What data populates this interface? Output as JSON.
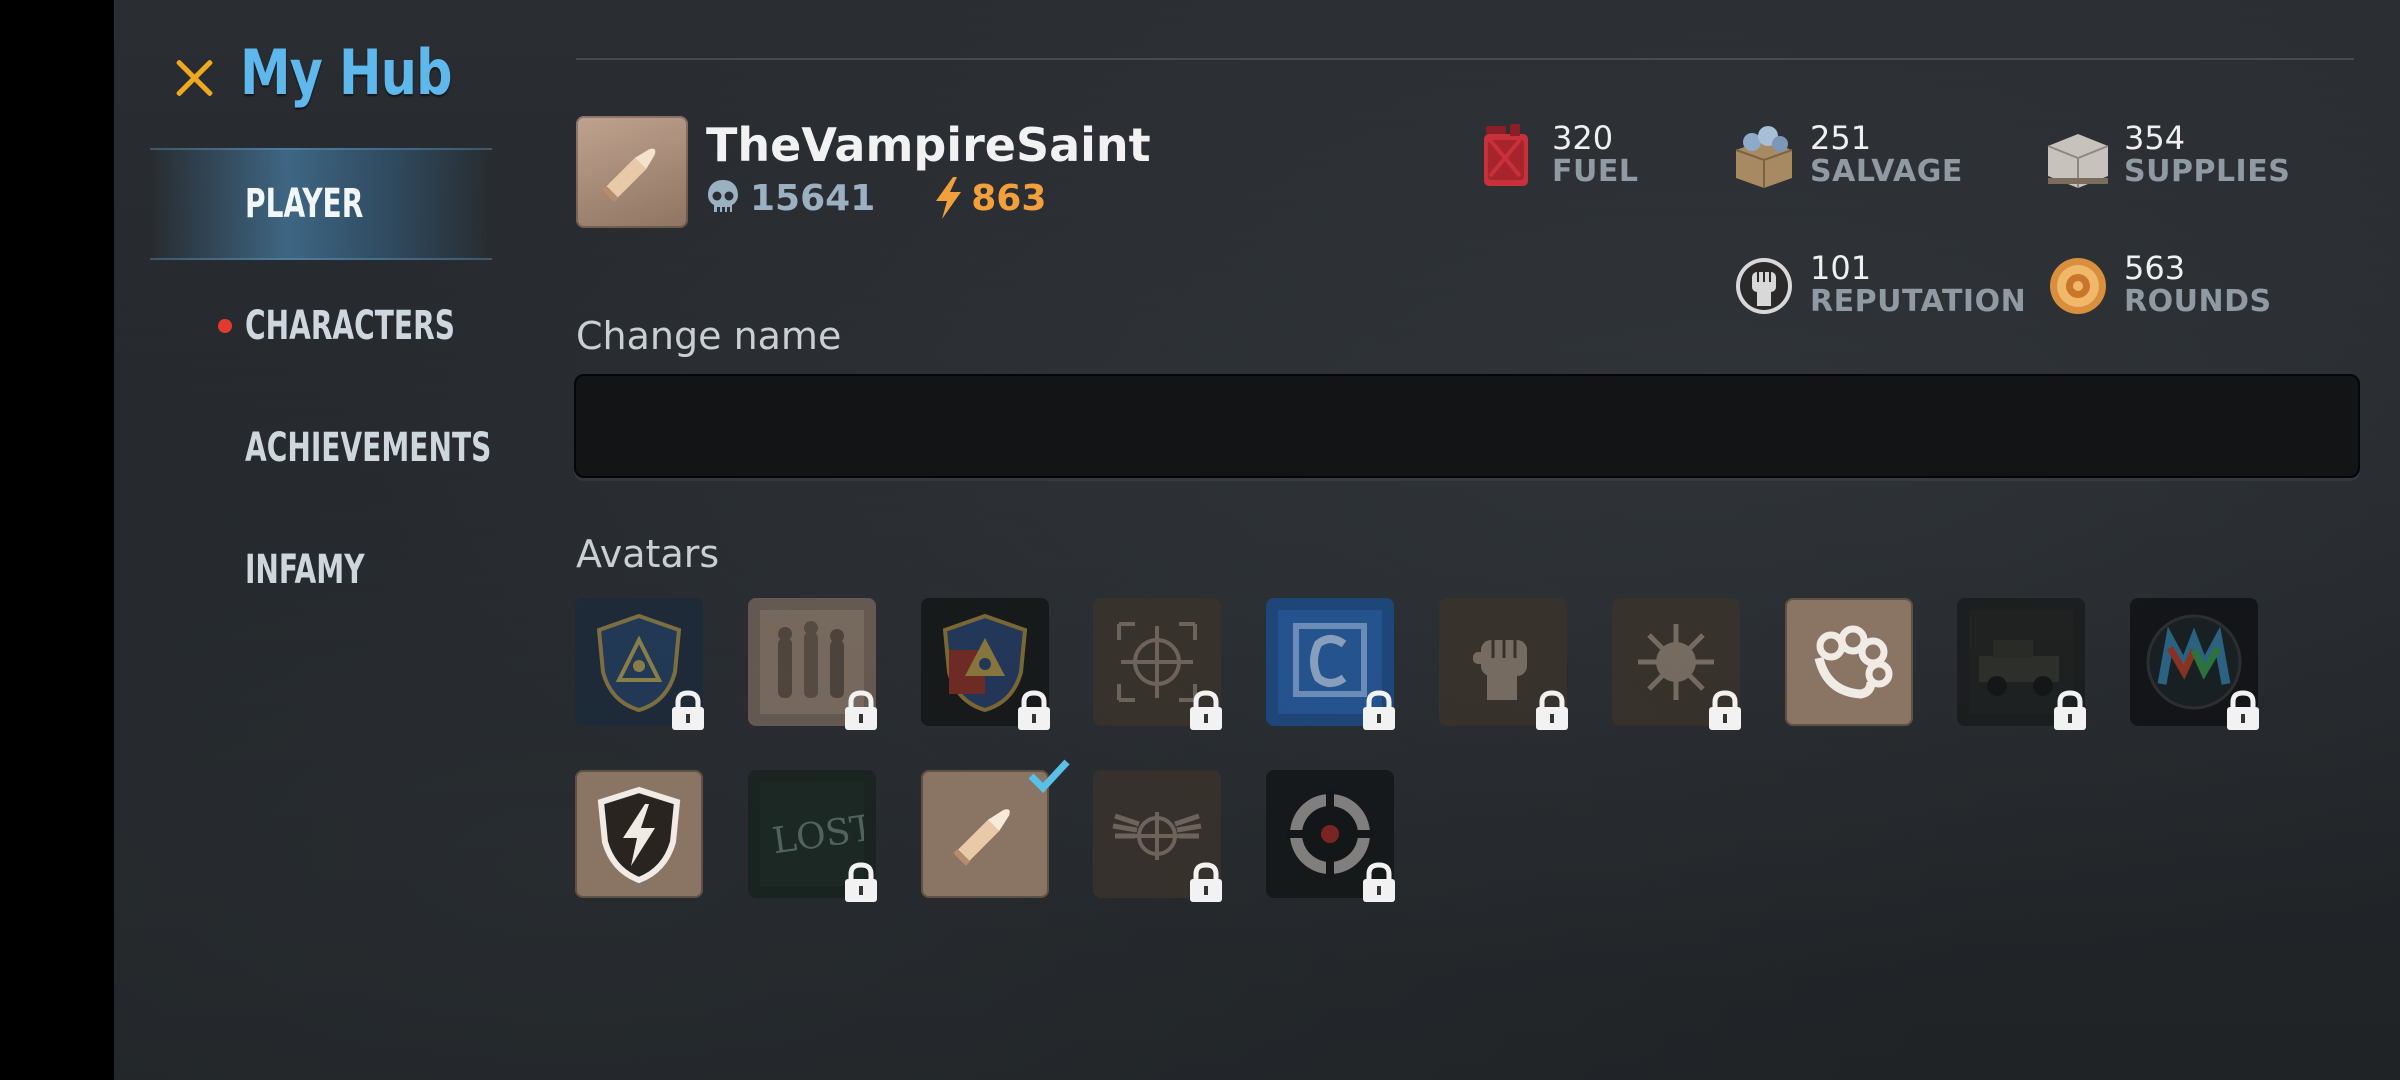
{
  "window": {
    "title": "My Hub"
  },
  "sidebar": {
    "items": [
      {
        "label": "PLAYER",
        "active": true,
        "notification": false
      },
      {
        "label": "CHARACTERS",
        "active": false,
        "notification": true
      },
      {
        "label": "ACHIEVEMENTS",
        "active": false,
        "notification": false
      },
      {
        "label": "INFAMY",
        "active": false,
        "notification": false
      }
    ]
  },
  "player": {
    "name": "TheVampireSaint",
    "skull_count": "15641",
    "energy": "863",
    "avatar_icon": "bullet-icon"
  },
  "resources": [
    {
      "value": "320",
      "label": "FUEL",
      "icon": "fuel-can-icon"
    },
    {
      "value": "251",
      "label": "SALVAGE",
      "icon": "salvage-crate-icon"
    },
    {
      "value": "354",
      "label": "SUPPLIES",
      "icon": "supplies-box-icon"
    },
    {
      "value": "101",
      "label": "REPUTATION",
      "icon": "fist-badge-icon"
    },
    {
      "value": "563",
      "label": "ROUNDS",
      "icon": "coin-icon"
    }
  ],
  "change_name": {
    "label": "Change name",
    "value": "",
    "placeholder": ""
  },
  "avatars": {
    "label": "Avatars",
    "items": [
      {
        "icon": "eye-shield-blue-icon",
        "locked": true,
        "selected": false
      },
      {
        "icon": "survivors-photo-icon",
        "locked": true,
        "selected": false
      },
      {
        "icon": "eye-shield-crest-icon",
        "locked": true,
        "selected": false
      },
      {
        "icon": "crosshair-icon",
        "locked": true,
        "selected": false
      },
      {
        "icon": "c-logo-icon",
        "locked": true,
        "selected": false
      },
      {
        "icon": "fist-icon",
        "locked": true,
        "selected": false
      },
      {
        "icon": "spiked-ball-icon",
        "locked": true,
        "selected": false
      },
      {
        "icon": "brass-knuckles-icon",
        "locked": false,
        "selected": false
      },
      {
        "icon": "truck-photo-icon",
        "locked": true,
        "selected": false
      },
      {
        "icon": "mw-logo-icon",
        "locked": true,
        "selected": false
      },
      {
        "icon": "lightning-shield-icon",
        "locked": false,
        "selected": false
      },
      {
        "icon": "lost-chalk-icon",
        "locked": true,
        "selected": false
      },
      {
        "icon": "bullet-icon",
        "locked": false,
        "selected": true
      },
      {
        "icon": "winged-crosshair-icon",
        "locked": true,
        "selected": false
      },
      {
        "icon": "target-icon",
        "locked": true,
        "selected": false
      }
    ]
  },
  "colors": {
    "accent": "#5fb8ec",
    "close": "#f0a81e",
    "energy": "#f2a03c",
    "notify": "#e33a2f",
    "check": "#5bc0e8"
  }
}
